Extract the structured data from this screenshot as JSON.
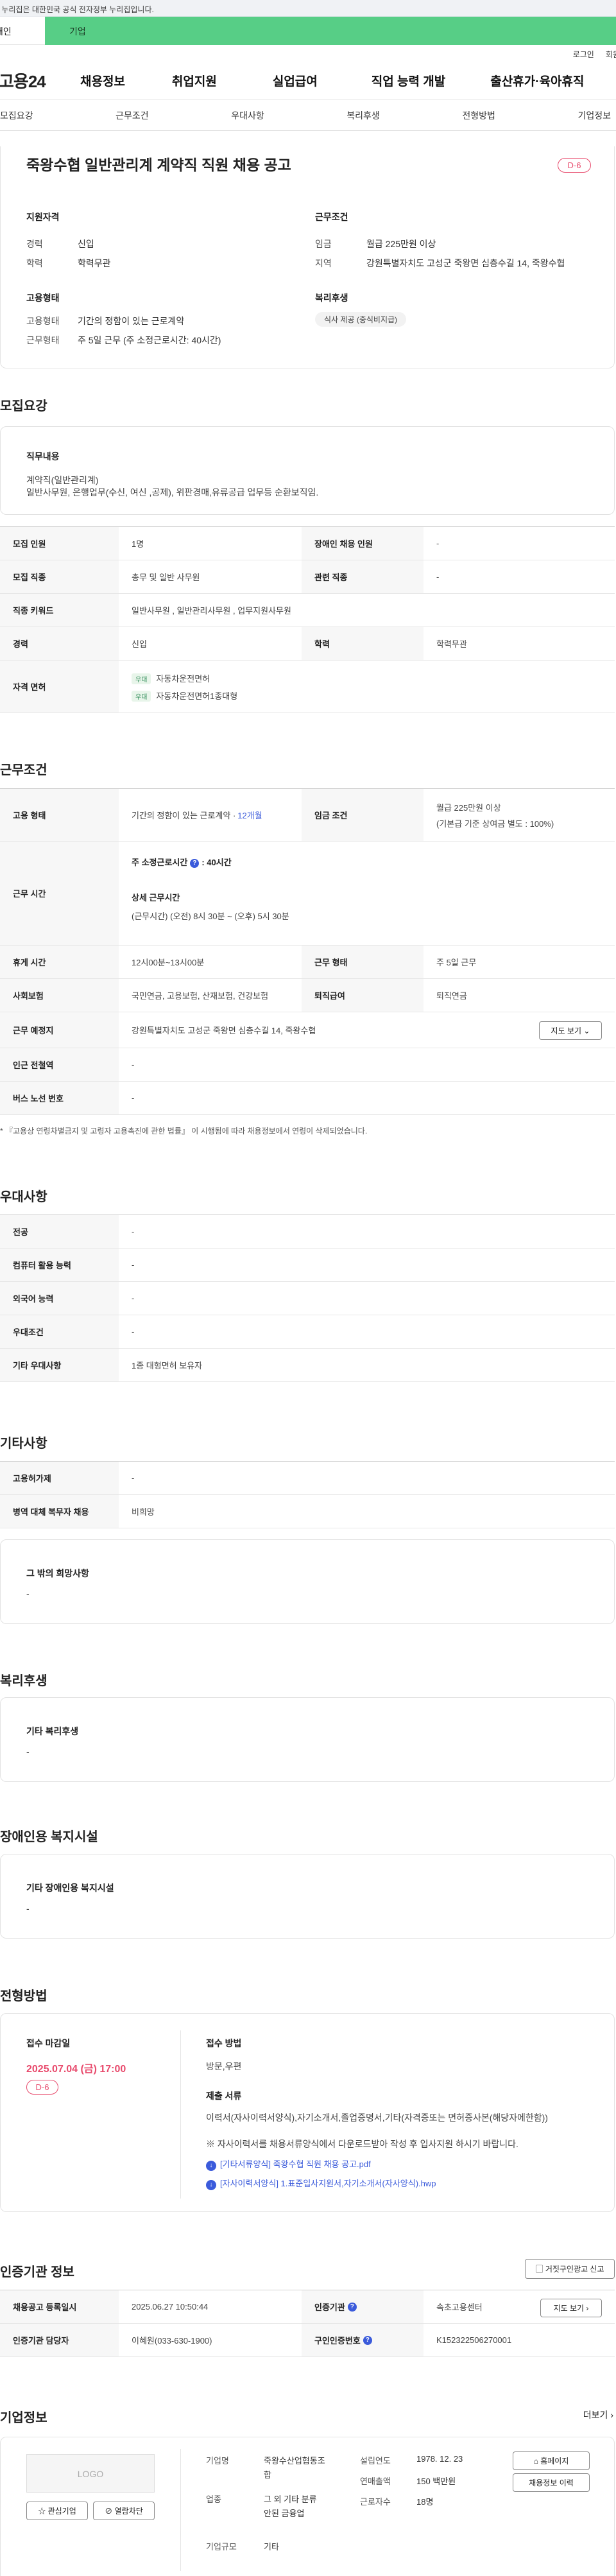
{
  "gov_banner": "이 누리집은 대한민국 공식 전자정부 누리집입니다.",
  "tabs": {
    "t1": "개인",
    "t2": "기업"
  },
  "util": {
    "login": "로그인",
    "join": "회원가입"
  },
  "gnb": {
    "logo": "고용24",
    "items": [
      "채용정보",
      "취업지원",
      "실업급여",
      "직업 능력 개발",
      "출산휴가·육아휴직"
    ]
  },
  "snb": [
    "모집요강",
    "근무조건",
    "우대사항",
    "복리후생",
    "전형방법",
    "기업정보"
  ],
  "hero": {
    "title": "죽왕수협 일반관리계 계약직 직원 채용 공고",
    "dday": "D-6",
    "qual_title": "지원자격",
    "career_k": "경력",
    "career_v": "신입",
    "edu_k": "학력",
    "edu_v": "학력무관",
    "cond_title": "근무조건",
    "wage_k": "임금",
    "wage_v": "월급 225만원 이상",
    "region_k": "지역",
    "region_v": "강원특별자치도 고성군 죽왕면 심층수길 14, 죽왕수협",
    "emp_title": "고용형태",
    "type_k": "고용형태",
    "type_v": "기간의 정함이 있는 근로계약",
    "shape_k": "근무형태",
    "shape_v": "주 5일 근무 (주 소정근로시간: 40시간)",
    "wel_title": "복리후생",
    "wel_chip": "식사 제공 (중식비지급)"
  },
  "recruit": {
    "title": "모집요강",
    "job_title": "직무내용",
    "job_line1": "계약직(일반관리계)",
    "job_line2": "일반사무원, 은행업무(수신, 여신 ,공제), 위판경매,유류공급 업무등 순환보직임.",
    "rows": [
      {
        "k1": "모집 인원",
        "v1": "1명",
        "k2": "장애인 채용 인원",
        "v2": "-"
      },
      {
        "k1": "모집 직종",
        "v1": "총무 및 일반 사무원",
        "k2": "관련 직종",
        "v2": "-"
      },
      {
        "k1": "직종 키워드",
        "v1": "일반사무원 , 일반관리사무원 , 업무지원사무원"
      },
      {
        "k1": "경력",
        "v1": "신입",
        "k2": "학력",
        "v2": "학력무관"
      },
      {
        "k1": "자격 면허",
        "tag": "우대",
        "lic1": "자동차운전면허",
        "lic2": "자동차운전면허1종대형"
      }
    ]
  },
  "cond": {
    "title": "근무조건",
    "emp_k": "고용 형태",
    "emp_v": "기간의 정함이 있는 근로계약 · ",
    "emp_months": "12개월",
    "wage_k": "임금 조건",
    "wage_v1": "월급 225만원 이상",
    "wage_v2": "(기본급 기준 상여금 별도 : 100%)",
    "time_k": "근무 시간",
    "time_l1": "주 소정근로시간",
    "time_l1b": ": 40시간",
    "time_l2": "상세 근무시간",
    "time_l3": "(근무시간) (오전) 8시 30분 ~ (오후) 5시 30분",
    "rest_k": "휴게 시간",
    "rest_v": "12시00분~13시00분",
    "shape_k": "근무 형태",
    "shape_v": "주 5일 근무",
    "ins_k": "사회보험",
    "ins_v": "국민연금, 고용보험, 산재보험, 건강보험",
    "ret_k": "퇴직급여",
    "ret_v": "퇴직연금",
    "place_k": "근무 예정지",
    "place_v": "강원특별자치도 고성군 죽왕면 심층수길 14, 죽왕수협",
    "map_btn": "지도 보기",
    "sta_k": "인근 전철역",
    "sta_v": "-",
    "bus_k": "버스 노선 번호",
    "bus_v": "-",
    "note": "* 『고용상 연령차별금지 및 고령자 고용촉진에 관한 법률』 이 시행됨에 따라 채용정보에서 연령이 삭제되었습니다."
  },
  "pref": {
    "title": "우대사항",
    "rows": [
      {
        "k": "전공",
        "v": "-"
      },
      {
        "k": "컴퓨터 활용 능력",
        "v": "-"
      },
      {
        "k": "외국어 능력",
        "v": "-"
      },
      {
        "k": "우대조건",
        "v": "-"
      },
      {
        "k": "기타 우대사항",
        "v": "1종 대형면허 보유자"
      }
    ]
  },
  "etc": {
    "title": "기타사항",
    "rows": [
      {
        "k": "고용허가제",
        "v": "-"
      },
      {
        "k": "병역 대체 복무자 채용",
        "v": "비희망"
      }
    ],
    "box_title": "그 밖의 희망사항",
    "box_v": "-"
  },
  "welfare": {
    "title": "복리후생",
    "box_title": "기타 복리후생",
    "box_v": "-"
  },
  "disab": {
    "title": "장애인용 복지시설",
    "box_title": "기타 장애인용 복지시설",
    "box_v": "-"
  },
  "process": {
    "title": "전형방법",
    "deadline_k": "접수 마감일",
    "deadline_v": "2025.07.04 (금) 17:00",
    "dday": "D-6",
    "method_k": "접수 방법",
    "method_v": "방문,우편",
    "docs_k": "제출 서류",
    "docs_v1": "이력서(자사이력서양식),자기소개서,졸업증명서,기타(자격증또는 면허증사본(해당자에한함))",
    "docs_v2": "※ 자사이력서를 채용서류양식에서 다운로드받아 작성 후 입사지원 하시기 바랍니다.",
    "file1": "[기타서류양식] 죽왕수협 직원 채용 공고.pdf",
    "file2": "[자사이력서양식] 1.표준입사지원서,자기소개서(자사양식).hwp"
  },
  "cert": {
    "title": "인증기관 정보",
    "report_btn": "거짓구인광고 신고",
    "reg_k": "채용공고 등록일시",
    "reg_v": "2025.06.27 10:50:44",
    "org_k": "인증기관",
    "org_v": "속초고용센터",
    "map_btn": "지도 보기",
    "mgr_k": "인증기관 담당자",
    "mgr_v": "이혜원(033-630-1900)",
    "num_k": "구인인증번호",
    "num_v": "K152322506270001"
  },
  "company": {
    "title": "기업정보",
    "more": "더보기",
    "logo": "LOGO",
    "fav_btn": "관심기업",
    "block_btn": "열람차단",
    "name_k": "기업명",
    "name_v1": "죽왕수산업협동조",
    "name_v2": "합",
    "ind_k": "업종",
    "ind_v1": "그 외 기타 분류",
    "ind_v2": "안된 금융업",
    "size_k": "기업규모",
    "size_v": "기타",
    "est_k": "설립연도",
    "est_v": "1978. 12. 23",
    "sales_k": "연매출액",
    "sales_v": "150 백만원",
    "emp_k": "근로자수",
    "emp_v": "18명",
    "home_btn": "홈페이지",
    "jobs_btn": "채용정보 이력"
  }
}
